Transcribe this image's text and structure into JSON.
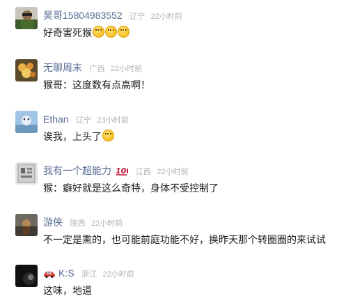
{
  "comments": [
    {
      "name": "昊哥15804983552",
      "location": "辽宁",
      "time": "22小时前",
      "text": "好奇害死猴",
      "emoji": [
        "thinking-face-icon",
        "thinking-face-icon",
        "thinking-face-icon"
      ]
    },
    {
      "name": "无聊周末",
      "location": "广西",
      "time": "22小时前",
      "text": "猴哥：这度数有点高啊！"
    },
    {
      "name": "Ethan",
      "location": "辽宁",
      "time": "23小时前",
      "text": "诶我，上头了",
      "emoji": [
        "dizzy-face-icon"
      ]
    },
    {
      "name": "我有一个超能力",
      "badge": "💯",
      "location": "江西",
      "time": "22小时前",
      "text": "猴：癖好就是这么奇特，身体不受控制了"
    },
    {
      "name": "游侠",
      "location": "陕西",
      "time": "22小时前",
      "text": "不一定是熏的，也可能前庭功能不好，换昨天那个转圈圈的来试试"
    },
    {
      "name": "K:S",
      "name_icon": "car-icon",
      "location": "浙江",
      "time": "22小时前",
      "text": "这味，地道"
    }
  ]
}
